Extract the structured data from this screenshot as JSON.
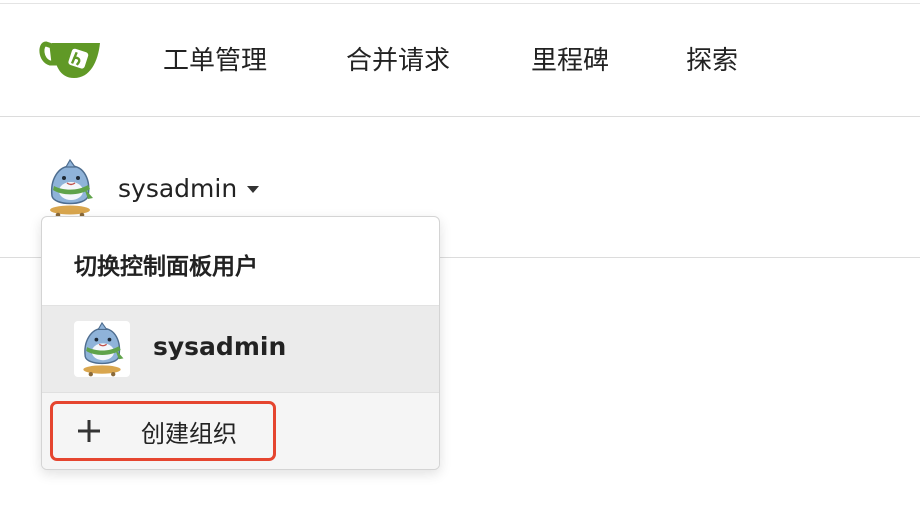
{
  "nav": {
    "logo_icon": "gitea-tea-cup-icon",
    "items": [
      {
        "label": "工单管理"
      },
      {
        "label": "合并请求"
      },
      {
        "label": "里程碑"
      },
      {
        "label": "探索"
      }
    ]
  },
  "context": {
    "user": "sysadmin",
    "avatar_icon": "user-avatar-shark-icon",
    "caret_icon": "caret-down-icon"
  },
  "dropdown": {
    "header": "切换控制面板用户",
    "users": [
      {
        "name": "sysadmin",
        "avatar_icon": "user-avatar-shark-icon"
      }
    ],
    "create": {
      "icon": "plus-icon",
      "label": "创建组织",
      "highlight_color": "#e5452f"
    }
  },
  "colors": {
    "brand_green": "#609926",
    "selected_bg": "#ebebeb"
  }
}
